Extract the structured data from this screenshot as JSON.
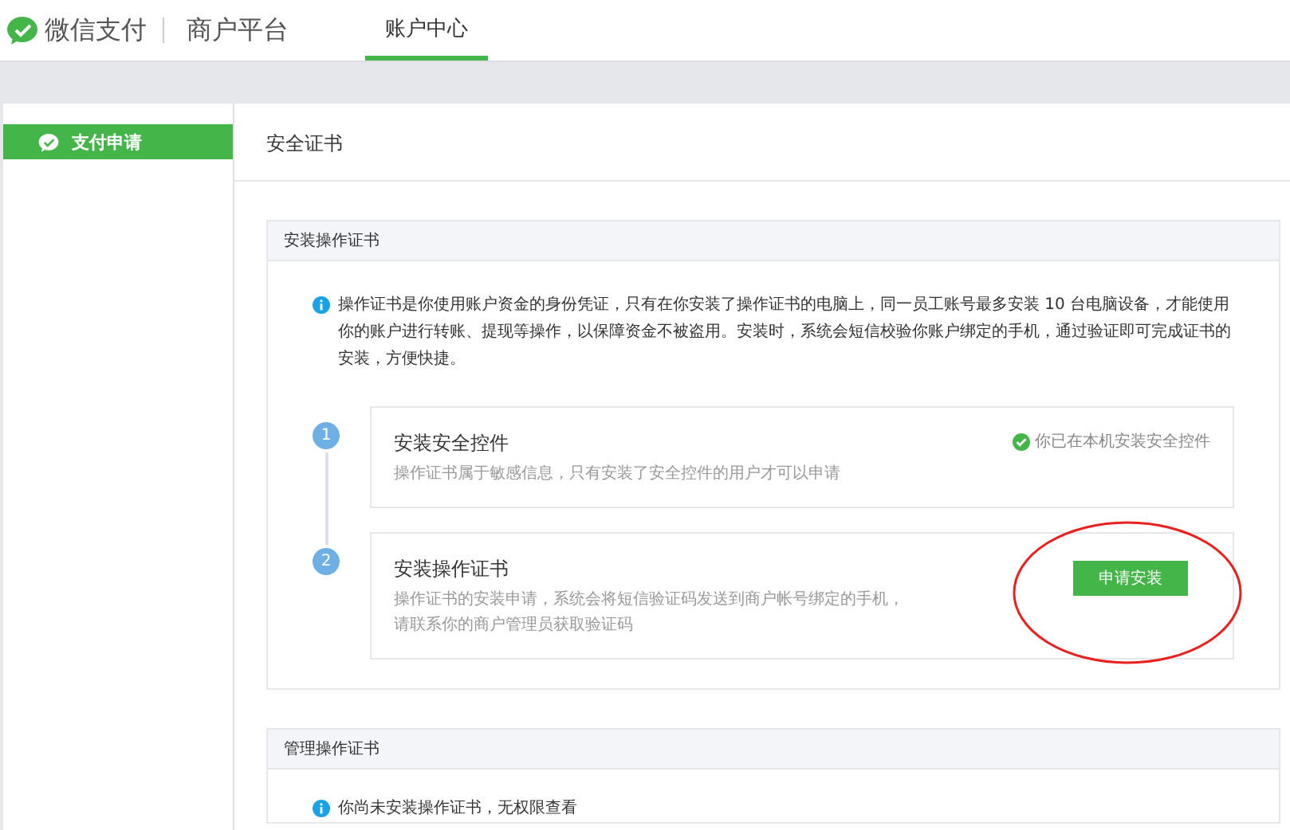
{
  "header": {
    "brand": "微信支付",
    "platform": "商户平台",
    "tabs": [
      {
        "label": "账户中心",
        "selected": true
      }
    ]
  },
  "sidebar": {
    "items": [
      {
        "label": "支付申请",
        "selected": true
      }
    ]
  },
  "page_title": "安全证书",
  "sections": [
    {
      "title": "安装操作证书",
      "info": "操作证书是你使用账户资金的身份凭证，只有在你安装了操作证书的电脑上，同一员工账号最多安装 10 台电脑设备，才能使用你的账户进行转账、提现等操作，以保障资金不被盗用。安装时，系统会短信校验你账户绑定的手机，通过验证即可完成证书的安装，方便快捷。",
      "steps": [
        {
          "number": "1",
          "title": "安装安全控件",
          "description": [
            "操作证书属于敏感信息，只有安装了安全控件的用户才可以申请"
          ],
          "kind": "status",
          "status": "你已在本机安装安全控件",
          "done": true
        },
        {
          "number": "2",
          "title": "安装操作证书",
          "description": [
            "操作证书的安装申请，系统会将短信验证码发送到商户帐号绑定的手机，",
            "请联系你的商户管理员获取验证码"
          ],
          "kind": "button",
          "button": "申请安装",
          "circled": true
        }
      ]
    },
    {
      "title": "管理操作证书",
      "info": "你尚未安装操作证书，无权限查看"
    }
  ]
}
